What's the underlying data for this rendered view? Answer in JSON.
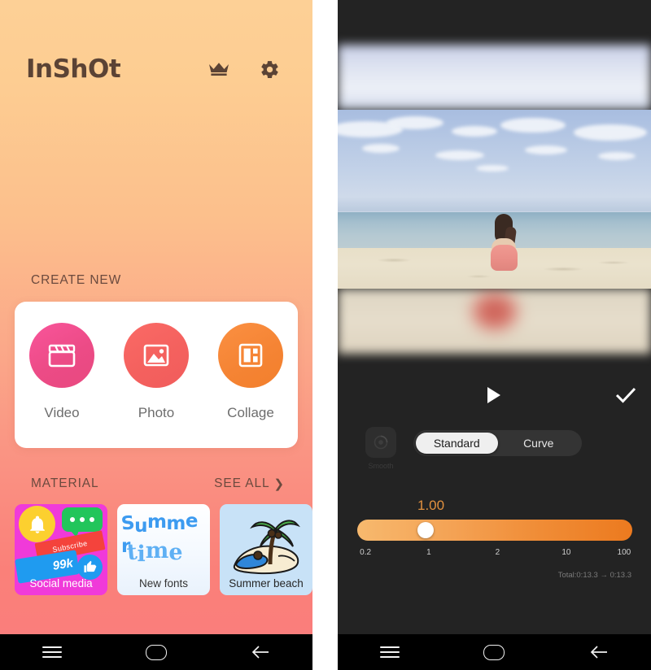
{
  "left_screen": {
    "header": {
      "brand": "InShOt",
      "crown_icon": "crown-icon",
      "gear_icon": "gear-icon"
    },
    "create_new": {
      "section_title": "CREATE NEW",
      "items": [
        {
          "label": "Video",
          "icon": "clapperboard-icon",
          "color": "#ec4b86"
        },
        {
          "label": "Photo",
          "icon": "image-icon",
          "color": "#f4615e"
        },
        {
          "label": "Collage",
          "icon": "collage-icon",
          "color": "#f58434"
        }
      ]
    },
    "material": {
      "section_title": "MATERIAL",
      "see_all_label": "SEE ALL",
      "see_all_chevron": "chevron-right-icon",
      "cards": [
        {
          "name": "Social media",
          "bg": "#f03ad9",
          "badge_count": "99k",
          "banner_text": "Subscribe",
          "icons": [
            "bell-icon",
            "speech-bubble-icon",
            "thumbs-up-icon"
          ]
        },
        {
          "name": "New fonts",
          "bg": "#eef5fd",
          "art_line1": "Summer",
          "art_line2": "time"
        },
        {
          "name": "Summer beach",
          "bg": "#c8e2f7",
          "icons": [
            "palm-tree-icon",
            "island-icon"
          ]
        }
      ]
    },
    "navbar": {
      "recents_icon": "recents-icon",
      "home_icon": "home-icon",
      "back_icon": "back-arrow-icon"
    }
  },
  "right_screen": {
    "preview": {
      "description": "beach video preview with blurred background fill"
    },
    "transport": {
      "play_icon": "play-icon",
      "confirm_icon": "check-icon"
    },
    "tools": {
      "smooth_label": "Smooth",
      "smooth_icon": "smooth-speed-icon",
      "segments": [
        {
          "label": "Standard",
          "selected": true
        },
        {
          "label": "Curve",
          "selected": false
        }
      ]
    },
    "speed": {
      "value": "1.00",
      "value_color": "#e2913f",
      "ticks": [
        "0.2",
        "1",
        "2",
        "10",
        "100"
      ],
      "thumb_percent": 22,
      "total_text": "Total:0:13.3  →  0:13.3"
    },
    "navbar": {
      "recents_icon": "recents-icon",
      "home_icon": "home-icon",
      "back_icon": "back-arrow-icon"
    }
  }
}
